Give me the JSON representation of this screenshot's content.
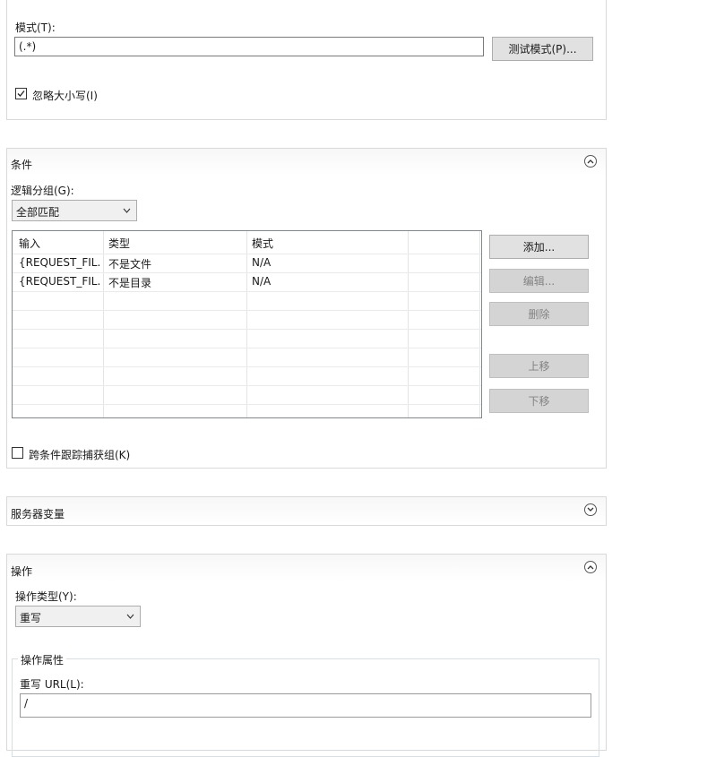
{
  "pattern_section": {
    "pattern_label": "模式(T):",
    "pattern_value": "(.*)",
    "test_pattern_button": "测试模式(P)...",
    "ignore_case_label": "忽略大小写(I)",
    "ignore_case_checked": true
  },
  "conditions": {
    "title": "条件",
    "logical_grouping_label": "逻辑分组(G):",
    "logical_grouping_value": "全部匹配",
    "table": {
      "columns": [
        "输入",
        "类型",
        "模式"
      ],
      "rows": [
        {
          "input": "{REQUEST_FIL...",
          "type": "不是文件",
          "pattern": "N/A"
        },
        {
          "input": "{REQUEST_FIL...",
          "type": "不是目录",
          "pattern": "N/A"
        }
      ]
    },
    "buttons": {
      "add": "添加...",
      "edit": "编辑...",
      "remove": "删除",
      "move_up": "上移",
      "move_down": "下移"
    },
    "track_captures_label": "跨条件跟踪捕获组(K)",
    "track_captures_checked": false
  },
  "server_variables": {
    "title": "服务器变量"
  },
  "action": {
    "title": "操作",
    "action_type_label": "操作类型(Y):",
    "action_type_value": "重写",
    "properties_title": "操作属性",
    "rewrite_url_label": "重写 URL(L):",
    "rewrite_url_value": "/"
  },
  "colors": {
    "button_face": "#e1e1e1",
    "disabled_text": "#838383",
    "border": "#d9d9d9"
  }
}
